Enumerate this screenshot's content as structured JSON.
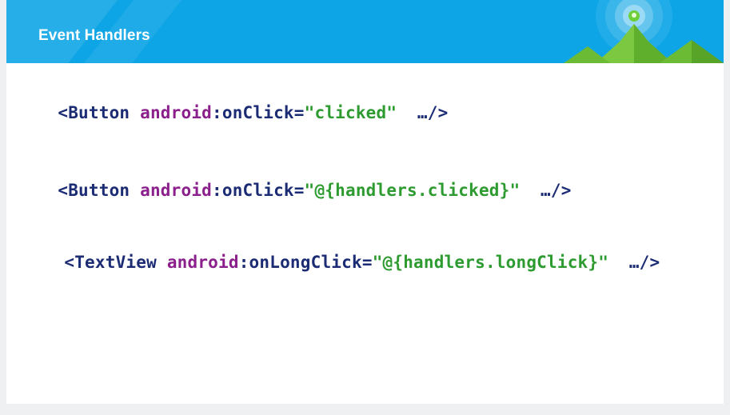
{
  "header": {
    "title": "Event Handlers"
  },
  "code_lines": [
    {
      "tag": "<Button",
      "attr_ns": "android",
      "attr": ":onClick=",
      "value": "\"clicked\"",
      "end": "…/>"
    },
    {
      "tag": "<Button",
      "attr_ns": "android",
      "attr": ":onClick=",
      "value": "\"@{handlers.clicked}\"",
      "end": "…/>"
    },
    {
      "tag": "<TextView",
      "attr_ns": "android",
      "attr": ":onLongClick=",
      "value": "\"@{handlers.longClick}\"",
      "end": "…/>"
    }
  ],
  "colors": {
    "header_bg": "#0ea5e6",
    "tag": "#1c2c74",
    "attr_ns": "#8b1f8b",
    "string": "#2e9b31"
  },
  "icons": {
    "logo": "android-studio-mountain-icon"
  }
}
